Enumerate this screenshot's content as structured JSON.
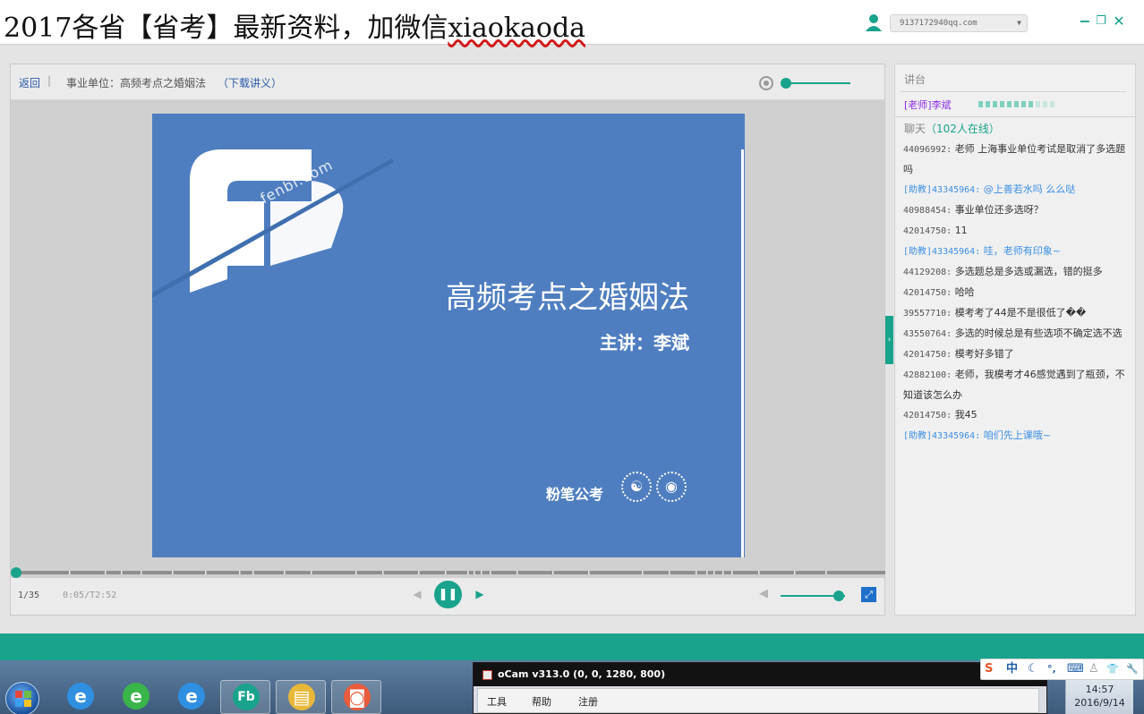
{
  "titlebar": {
    "banner_prefix": "2017各省【省考】最新资料，加微信",
    "banner_wechat": "xiaokaoda",
    "account": "9137172940qq.com",
    "minimize": "−",
    "restore": "❐",
    "close": "✕"
  },
  "player": {
    "back": "返回",
    "separator": "|",
    "lecture": "事业单位：高频考点之婚姻法",
    "download": "（下载讲义）",
    "slide": {
      "watermark_url": "http://ke.fenbi.com",
      "title": "高频考点之婚姻法",
      "subtitle": "主讲：李斌",
      "brand": "粉笔公考",
      "weibo_icon": "☯",
      "wechat_icon": "◉"
    },
    "page": "1/35",
    "time": "0:05/T2:52",
    "progress": 0.001,
    "volume": 0.9,
    "prev_glyph": "◀",
    "play_glyph": "❚❚",
    "next_glyph": "▶",
    "volume_glyph": "◀",
    "fullscreen_glyph": "⤢",
    "side_toggle_glyph": "›"
  },
  "panel": {
    "podium": "讲台",
    "teacher": "[老师]李斌",
    "chat_title": "聊天",
    "online": "（102人在线）",
    "messages": [
      {
        "uid": "44096992:",
        "text": "老师 上海事业单位考试是取消了多选题吗",
        "assistant": false
      },
      {
        "uid": "[助教]43345964:",
        "text": "@上善若水吗 么么哒",
        "assistant": true
      },
      {
        "uid": "40988454:",
        "text": "事业单位还多选呀？",
        "assistant": false
      },
      {
        "uid": "42014750:",
        "text": "11",
        "assistant": false
      },
      {
        "uid": "[助教]43345964:",
        "text": "哇，老师有印象~",
        "assistant": true
      },
      {
        "uid": "44129208:",
        "text": "多选题总是多选或漏选，错的挺多",
        "assistant": false
      },
      {
        "uid": "42014750:",
        "text": "哈哈",
        "assistant": false
      },
      {
        "uid": "39557710:",
        "text": "模考考了44是不是很低了��",
        "assistant": false
      },
      {
        "uid": "43550764:",
        "text": "多选的时候总是有些选项不确定选不选",
        "assistant": false
      },
      {
        "uid": "42014750:",
        "text": "模考好多错了",
        "assistant": false
      },
      {
        "uid": "42882100:",
        "text": "老师，我模考才46感觉遇到了瓶颈，不知道该怎么办",
        "assistant": false
      },
      {
        "uid": "42014750:",
        "text": "我45",
        "assistant": false
      },
      {
        "uid": "[助教]43345964:",
        "text": "咱们先上课哦~",
        "assistant": true
      }
    ]
  },
  "taskbar": {
    "apps": [
      {
        "name": "ie-icon",
        "glyph": "e",
        "color": "#2f8fe0"
      },
      {
        "name": "360-browser-icon",
        "glyph": "e",
        "color": "#39b54a"
      },
      {
        "name": "ie-icon-2",
        "glyph": "e",
        "color": "#2f8fe0"
      },
      {
        "name": "fenbi-app-icon",
        "glyph": "Fb",
        "color": "#19a38c"
      },
      {
        "name": "file-explorer-icon",
        "glyph": "▤",
        "color": "#e8b83a"
      },
      {
        "name": "ocam-taskbar-icon",
        "glyph": "◙",
        "color": "#e85c3c"
      }
    ],
    "ocam_title": "oCam v313.0 (0, 0, 1280, 800)",
    "ocam_menu": [
      "工具",
      "帮助",
      "注册"
    ],
    "ime": [
      "S",
      "中",
      "☾",
      "°,",
      "⌨",
      "♙",
      "👕",
      "🔧"
    ],
    "time": "14:57",
    "date": "2016/9/14"
  },
  "colors": {
    "accent": "#19a38c",
    "slide_bg": "#4f7ec0",
    "link": "#2a5aa8",
    "assistant": "#3c8fe3",
    "teacher": "#8a2be2"
  }
}
